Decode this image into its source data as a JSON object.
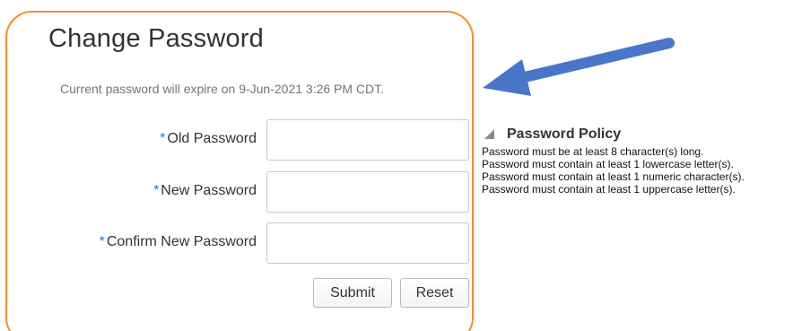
{
  "form": {
    "title": "Change Password",
    "expire_note": "Current password will expire on 9-Jun-2021 3:26 PM CDT.",
    "required_marker": "*",
    "fields": [
      {
        "label": "Old Password",
        "value": ""
      },
      {
        "label": "New Password",
        "value": ""
      },
      {
        "label": "Confirm New Password",
        "value": ""
      }
    ],
    "submit_label": "Submit",
    "reset_label": "Reset"
  },
  "policy": {
    "title": "Password Policy",
    "collapse_icon": "triangle-collapse-icon",
    "rules": [
      "Password must be at least 8 character(s) long.",
      "Password must contain at least 1 lowercase letter(s).",
      "Password must contain at least 1 numeric character(s).",
      "Password must contain at least 1 uppercase letter(s)."
    ]
  },
  "annotation": {
    "arrow_icon": "arrow-pointer-icon",
    "arrow_color": "#4a76c9",
    "highlight_color": "#f0902e"
  },
  "colors": {
    "required_marker": "#2b78c6",
    "muted_text": "#757575"
  }
}
